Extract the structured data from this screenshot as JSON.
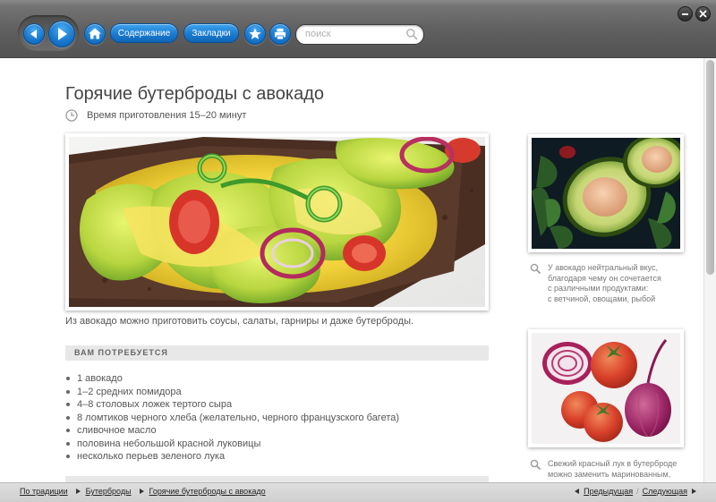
{
  "toolbar": {
    "contents_label": "Содержание",
    "bookmarks_label": "Закладки",
    "search_placeholder": "поиск"
  },
  "article": {
    "title": "Горячие бутерброды с авокадо",
    "cook_time": "Время приготовления 15–20 минут",
    "intro": "Из авокадо можно приготовить соусы, салаты, гарниры и даже бутерброды.",
    "ingredients_heading": "ВАМ ПОТРЕБУЕТСЯ",
    "ingredients": [
      "1 авокадо",
      "1–2 средних помидора",
      "4–8 столовых ложек тертого сыра",
      "8 ломтиков черного хлеба (желательно, черного французского багета)",
      "сливочное масло",
      "половина небольшой красной луковицы",
      "несколько перьев зеленого лука"
    ]
  },
  "sidebar": {
    "caption1": [
      "У авокадо нейтральный вкус,",
      "благодаря чему он сочетается",
      "с различными продуктами:",
      "с ветчиной, овощами, рыбой"
    ],
    "caption2": [
      "Свежий красный лук в бутерброде",
      "можно заменить маринованным,"
    ]
  },
  "breadcrumb": {
    "items": [
      "По традиции",
      "Бутерброды",
      "Горячие бутерброды с авокадо"
    ]
  },
  "pager": {
    "prev_label": "Предыдущая",
    "sep": "/",
    "next_label": "Следующая"
  },
  "colors": {
    "accent_blue": "#1877cc",
    "toolbar_gray": "#5e5e5e"
  }
}
